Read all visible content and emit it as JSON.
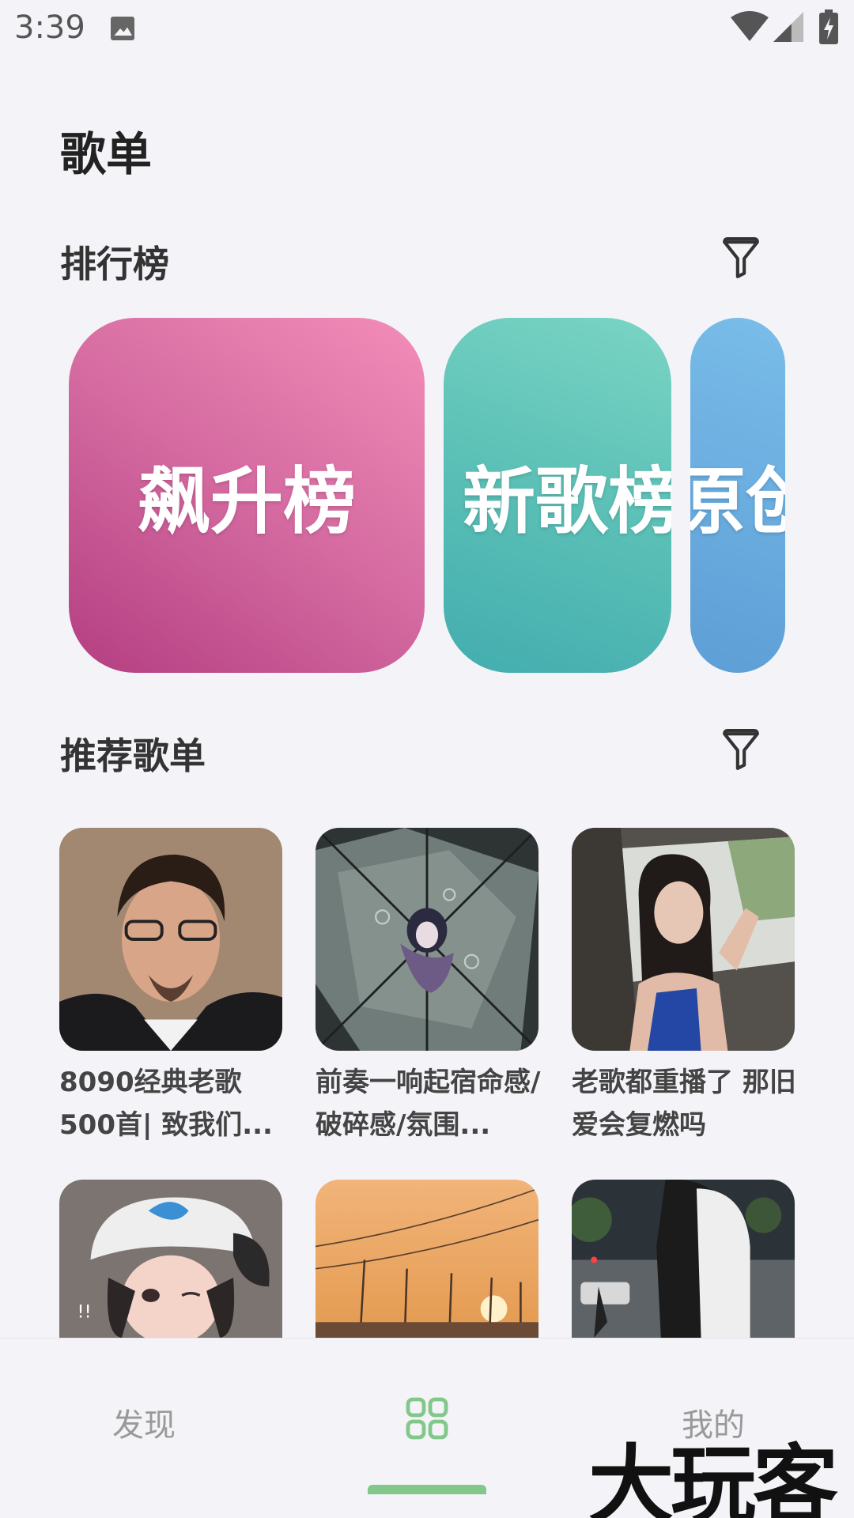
{
  "status_bar": {
    "time": "3:39",
    "icons": [
      "image-icon",
      "wifi-icon",
      "signal-icon",
      "battery-charging-icon"
    ]
  },
  "page": {
    "title": "歌单"
  },
  "ranking": {
    "title": "排行榜",
    "filter_icon": "filter-icon",
    "cards": [
      {
        "label": "飙升榜",
        "color": "#d46aa0"
      },
      {
        "label": "新歌榜",
        "color": "#5bc0b6"
      },
      {
        "label": "原创榜",
        "color": "#5d9ed6"
      }
    ]
  },
  "recommended": {
    "title": "推荐歌单",
    "filter_icon": "filter-icon",
    "playlists": [
      {
        "caption": "8090经典老歌500首| 致我们..."
      },
      {
        "caption": "前奏一响起宿命感/破碎感/氛围..."
      },
      {
        "caption": "老歌都重播了 那旧爱会复燃吗"
      },
      {
        "caption": ""
      },
      {
        "caption": ""
      },
      {
        "caption": ""
      }
    ]
  },
  "bottom_nav": {
    "items": [
      {
        "label": "发现",
        "active": false
      },
      {
        "label": "",
        "icon": "grid-icon",
        "active": true
      },
      {
        "label": "我的",
        "active": false
      }
    ],
    "active_color": "#82c88a"
  },
  "watermark": "大玩客"
}
